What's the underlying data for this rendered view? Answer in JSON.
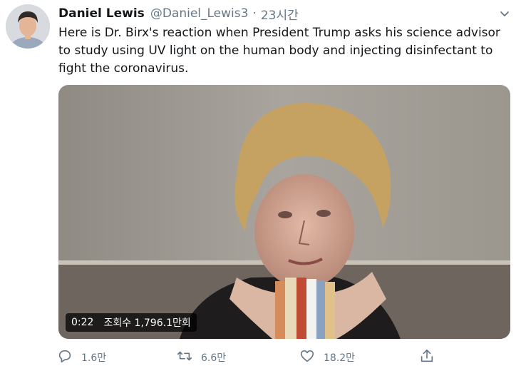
{
  "tweet": {
    "author_name": "Daniel Lewis",
    "author_handle": "@Daniel_Lewis3",
    "separator": "·",
    "time": "23시간",
    "text": "Here is Dr. Birx's reaction when President Trump asks his science advisor to study using UV light on the human body and injecting disinfectant to fight the coronavirus."
  },
  "video": {
    "duration": "0:22",
    "views": "조회수 1,796.1만회"
  },
  "actions": {
    "reply_count": "1.6만",
    "retweet_count": "6.6만",
    "like_count": "18.2만"
  },
  "icons": {
    "avatar": "avatar",
    "more": "chevron-down-icon",
    "reply": "reply-icon",
    "retweet": "retweet-icon",
    "like": "heart-icon",
    "share": "share-icon"
  },
  "colors": {
    "text": "#14171a",
    "secondary": "#657786",
    "background": "#ffffff"
  }
}
